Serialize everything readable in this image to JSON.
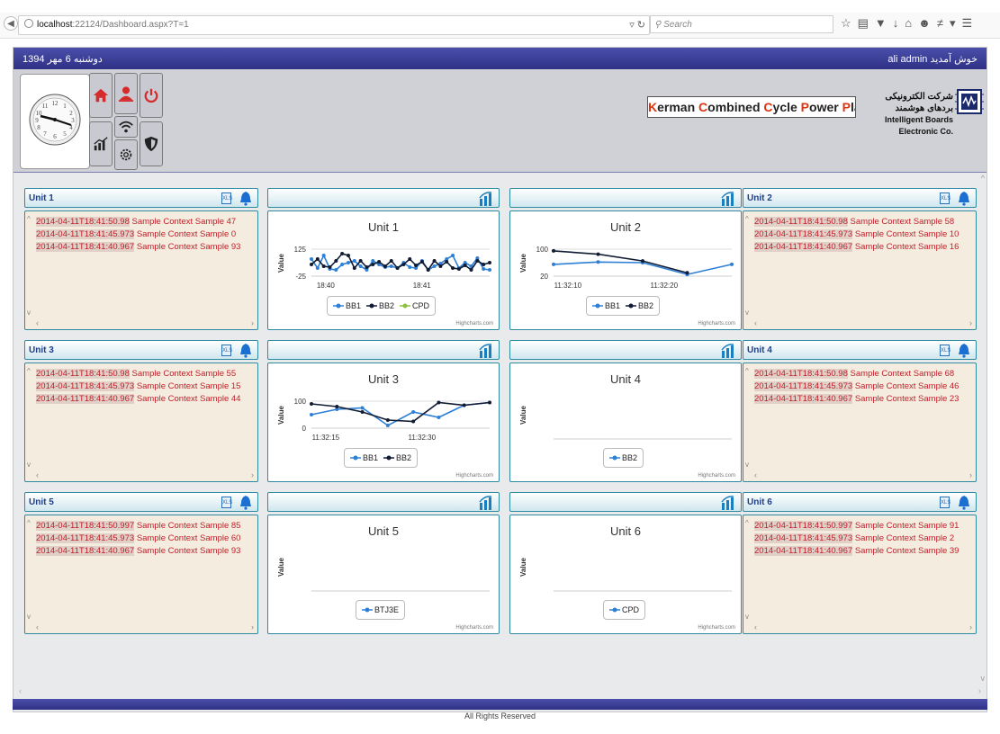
{
  "browser": {
    "host": "localhost",
    "url_rest": ":22124/Dashboard.aspx?T=1",
    "search_placeholder": "Search"
  },
  "header": {
    "date": "دوشنبه 6 مهر 1394",
    "welcome": "ali admin  خوش آمدید",
    "brand": [
      {
        "cap": "K",
        "rest": "erman "
      },
      {
        "cap": "C",
        "rest": "ombined "
      },
      {
        "cap": "C",
        "rest": "ycle "
      },
      {
        "cap": "P",
        "rest": "ower "
      },
      {
        "cap": "P",
        "rest": "lant"
      }
    ],
    "company_fa": "شرکت الکترونیکی بردهای هوشمند",
    "company_en": "Intelligent Boards Electronic Co."
  },
  "nav": [
    {
      "name": "home",
      "color": "#d62b2b"
    },
    {
      "name": "user",
      "color": "#d62b2b"
    },
    {
      "name": "power",
      "color": "#d62b2b"
    },
    {
      "name": "reports",
      "color": "#222"
    },
    {
      "name": "wifi",
      "color": "#222"
    },
    {
      "name": "settings",
      "color": "#222"
    },
    {
      "name": "shield",
      "color": "#222"
    }
  ],
  "logs": [
    {
      "title": "Unit 1",
      "lines": [
        {
          "ts": "2014-04-11T18:41:50.98",
          "msg": "Sample Context Sample 47"
        },
        {
          "ts": "2014-04-11T18:41:45.973",
          "msg": "Sample Context Sample 0"
        },
        {
          "ts": "2014-04-11T18:41:40.967",
          "msg": "Sample Context Sample 93"
        }
      ]
    },
    {
      "title": "Unit 2",
      "lines": [
        {
          "ts": "2014-04-11T18:41:50.98",
          "msg": "Sample Context Sample 58"
        },
        {
          "ts": "2014-04-11T18:41:45.973",
          "msg": "Sample Context Sample 10"
        },
        {
          "ts": "2014-04-11T18:41:40.967",
          "msg": "Sample Context Sample 16"
        }
      ]
    },
    {
      "title": "Unit 3",
      "lines": [
        {
          "ts": "2014-04-11T18:41:50.98",
          "msg": "Sample Context Sample 55"
        },
        {
          "ts": "2014-04-11T18:41:45.973",
          "msg": "Sample Context Sample 15"
        },
        {
          "ts": "2014-04-11T18:41:40.967",
          "msg": "Sample Context Sample 44"
        }
      ]
    },
    {
      "title": "Unit 4",
      "lines": [
        {
          "ts": "2014-04-11T18:41:50.98",
          "msg": "Sample Context Sample 68"
        },
        {
          "ts": "2014-04-11T18:41:45.973",
          "msg": "Sample Context Sample 46"
        },
        {
          "ts": "2014-04-11T18:41:40.967",
          "msg": "Sample Context Sample 23"
        }
      ]
    },
    {
      "title": "Unit 5",
      "lines": [
        {
          "ts": "2014-04-11T18:41:50.997",
          "msg": "Sample Context Sample 85"
        },
        {
          "ts": "2014-04-11T18:41:45.973",
          "msg": "Sample Context Sample 60"
        },
        {
          "ts": "2014-04-11T18:41:40.967",
          "msg": "Sample Context Sample 93"
        }
      ]
    },
    {
      "title": "Unit 6",
      "lines": [
        {
          "ts": "2014-04-11T18:41:50.997",
          "msg": "Sample Context Sample 91"
        },
        {
          "ts": "2014-04-11T18:41:45.973",
          "msg": "Sample Context Sample 2"
        },
        {
          "ts": "2014-04-11T18:41:40.967",
          "msg": "Sample Context Sample 39"
        }
      ]
    }
  ],
  "credit": "Highcharts.com",
  "footer": "All Rights Reserved",
  "chart_data": [
    {
      "type": "line",
      "title": "Unit 1",
      "ylabel": "Value",
      "ylim": [
        -25,
        125
      ],
      "yticks": [
        "125",
        "-25"
      ],
      "xticks": [
        "18:40",
        "18:41"
      ],
      "series": [
        {
          "name": "BB1",
          "color": "#2d7fd6",
          "values": [
            70,
            20,
            90,
            15,
            10,
            40,
            50,
            60,
            30,
            10,
            60,
            40,
            25,
            30,
            20,
            50,
            25,
            20,
            60,
            10,
            30,
            45,
            70,
            90,
            20,
            50,
            30,
            75,
            15,
            10
          ]
        },
        {
          "name": "BB2",
          "color": "#111c33",
          "values": [
            40,
            70,
            30,
            25,
            60,
            100,
            90,
            20,
            60,
            25,
            40,
            55,
            30,
            60,
            20,
            40,
            70,
            35,
            55,
            10,
            60,
            30,
            55,
            20,
            15,
            35,
            10,
            60,
            40,
            50
          ]
        },
        {
          "name": "CPD",
          "color": "#8fc13f",
          "values": []
        }
      ]
    },
    {
      "type": "line",
      "title": "Unit 2",
      "ylabel": "Value",
      "ylim": [
        20,
        100
      ],
      "yticks": [
        "100",
        "20"
      ],
      "xticks": [
        "11:32:10",
        "11:32:20"
      ],
      "series": [
        {
          "name": "BB1",
          "color": "#2d7fd6",
          "values": [
            55,
            62,
            60,
            25,
            55
          ]
        },
        {
          "name": "BB2",
          "color": "#111c33",
          "values": [
            95,
            85,
            65,
            30,
            null
          ]
        }
      ]
    },
    {
      "type": "line",
      "title": "Unit 3",
      "ylabel": "Value",
      "ylim": [
        0,
        100
      ],
      "yticks": [
        "100",
        "0"
      ],
      "xticks": [
        "11:32:15",
        "11:32:30"
      ],
      "series": [
        {
          "name": "BB1",
          "color": "#2d7fd6",
          "values": [
            50,
            70,
            75,
            10,
            60,
            40,
            85,
            95
          ]
        },
        {
          "name": "BB2",
          "color": "#111c33",
          "values": [
            90,
            80,
            60,
            30,
            25,
            95,
            85,
            95
          ]
        }
      ]
    },
    {
      "type": "line",
      "title": "Unit 4",
      "ylabel": "Value",
      "series": [
        {
          "name": "BB2",
          "color": "#2d7fd6",
          "values": []
        }
      ]
    },
    {
      "type": "line",
      "title": "Unit 5",
      "ylabel": "Value",
      "series": [
        {
          "name": "BTJ3E",
          "color": "#2d7fd6",
          "values": []
        }
      ]
    },
    {
      "type": "line",
      "title": "Unit 6",
      "ylabel": "Value",
      "series": [
        {
          "name": "CPD",
          "color": "#2d7fd6",
          "values": []
        }
      ]
    }
  ]
}
